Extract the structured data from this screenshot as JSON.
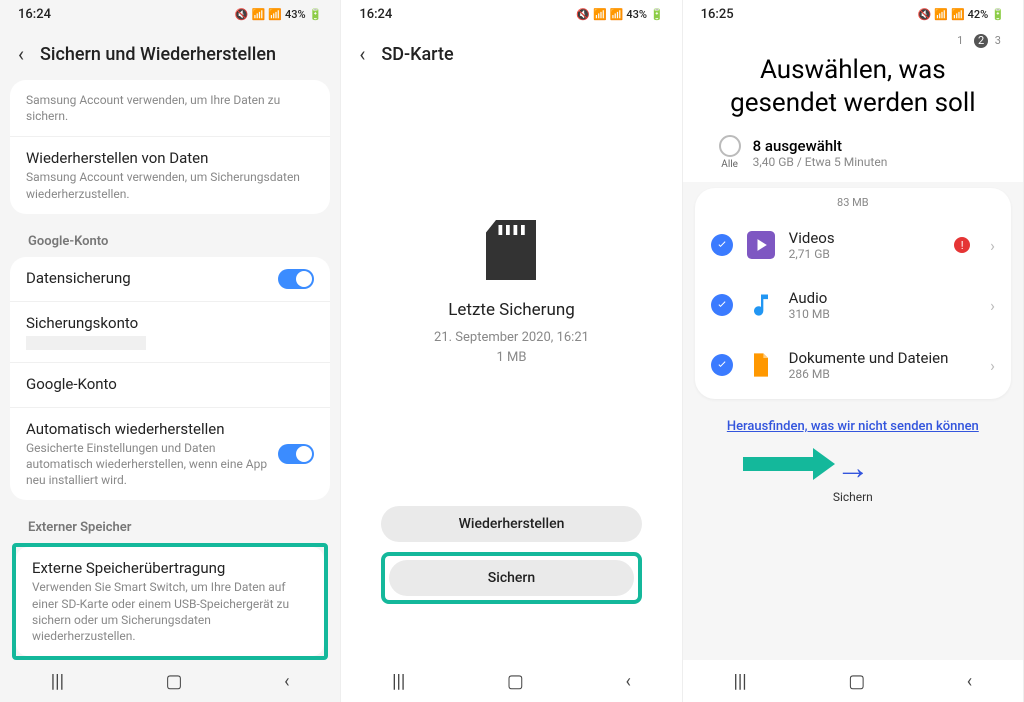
{
  "phone1": {
    "time": "16:24",
    "battery": "43%",
    "title": "Sichern und Wiederherstellen",
    "item_top_sub": "Samsung Account verwenden, um Ihre Daten zu sichern.",
    "restore_title": "Wiederherstellen von Daten",
    "restore_sub": "Samsung Account verwenden, um Sicherungsdaten wiederherzustellen.",
    "section_google": "Google-Konto",
    "datasich": "Datensicherung",
    "sichkonto": "Sicherungskonto",
    "googlekonto": "Google-Konto",
    "auto_title": "Automatisch wiederherstellen",
    "auto_sub": "Gesicherte Einstellungen und Daten automatisch wiederherstellen, wenn eine App neu installiert wird.",
    "section_ext": "Externer Speicher",
    "ext_title": "Externe Speicherübertragung",
    "ext_sub": "Verwenden Sie Smart Switch, um Ihre Daten auf einer SD-Karte oder einem USB-Speichergerät zu sichern oder um Sicherungsdaten wiederherzustellen."
  },
  "phone2": {
    "time": "16:24",
    "battery": "43%",
    "title": "SD-Karte",
    "center_title": "Letzte Sicherung",
    "center_date": "21. September 2020, 16:21",
    "center_size": "1 MB",
    "btn_restore": "Wiederherstellen",
    "btn_backup": "Sichern"
  },
  "phone3": {
    "time": "16:25",
    "battery": "42%",
    "steps": {
      "s1": "1",
      "s2": "2",
      "s3": "3"
    },
    "big_title": "Auswählen, was gesendet werden soll",
    "alle": "Alle",
    "selected_title": "8 ausgewählt",
    "selected_sub": "3,40 GB / Etwa 5 Minuten",
    "peek": "83 MB",
    "items": [
      {
        "name": "Videos",
        "size": "2,71 GB",
        "warn": true
      },
      {
        "name": "Audio",
        "size": "310 MB",
        "warn": false
      },
      {
        "name": "Dokumente und Dateien",
        "size": "286 MB",
        "warn": false
      }
    ],
    "link": "Herausfinden, was wir nicht senden können",
    "action_label": "Sichern"
  }
}
